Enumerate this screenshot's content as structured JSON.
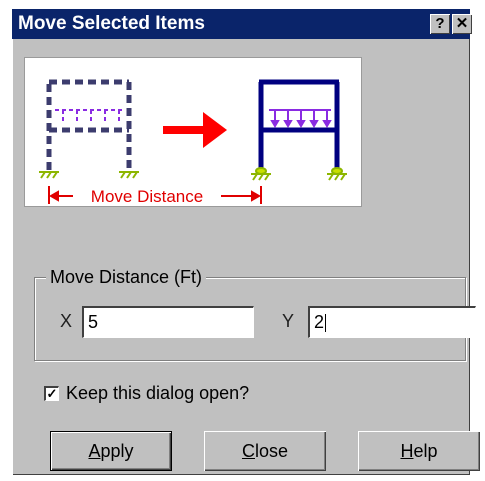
{
  "window": {
    "title": "Move Selected Items",
    "help_button": "?",
    "close_button": "✕"
  },
  "illustration": {
    "caption": "Move Distance",
    "colors": {
      "frame_original": "#3c3c6e",
      "frame_moved": "#000080",
      "load": "#8a2be2",
      "arrow": "#ff0000",
      "support": "#8db600",
      "caption": "#e00000"
    }
  },
  "move_distance": {
    "group_label": "Move Distance (Ft)",
    "x_label": "X",
    "x_value": "5",
    "y_label": "Y",
    "y_value": "2"
  },
  "options": {
    "keep_open_label": "Keep this dialog open?",
    "keep_open_checked": true
  },
  "buttons": {
    "apply": {
      "mnemonic": "A",
      "rest": "pply"
    },
    "close": {
      "mnemonic": "C",
      "rest": "lose"
    },
    "help": {
      "mnemonic": "H",
      "rest": "elp"
    }
  }
}
